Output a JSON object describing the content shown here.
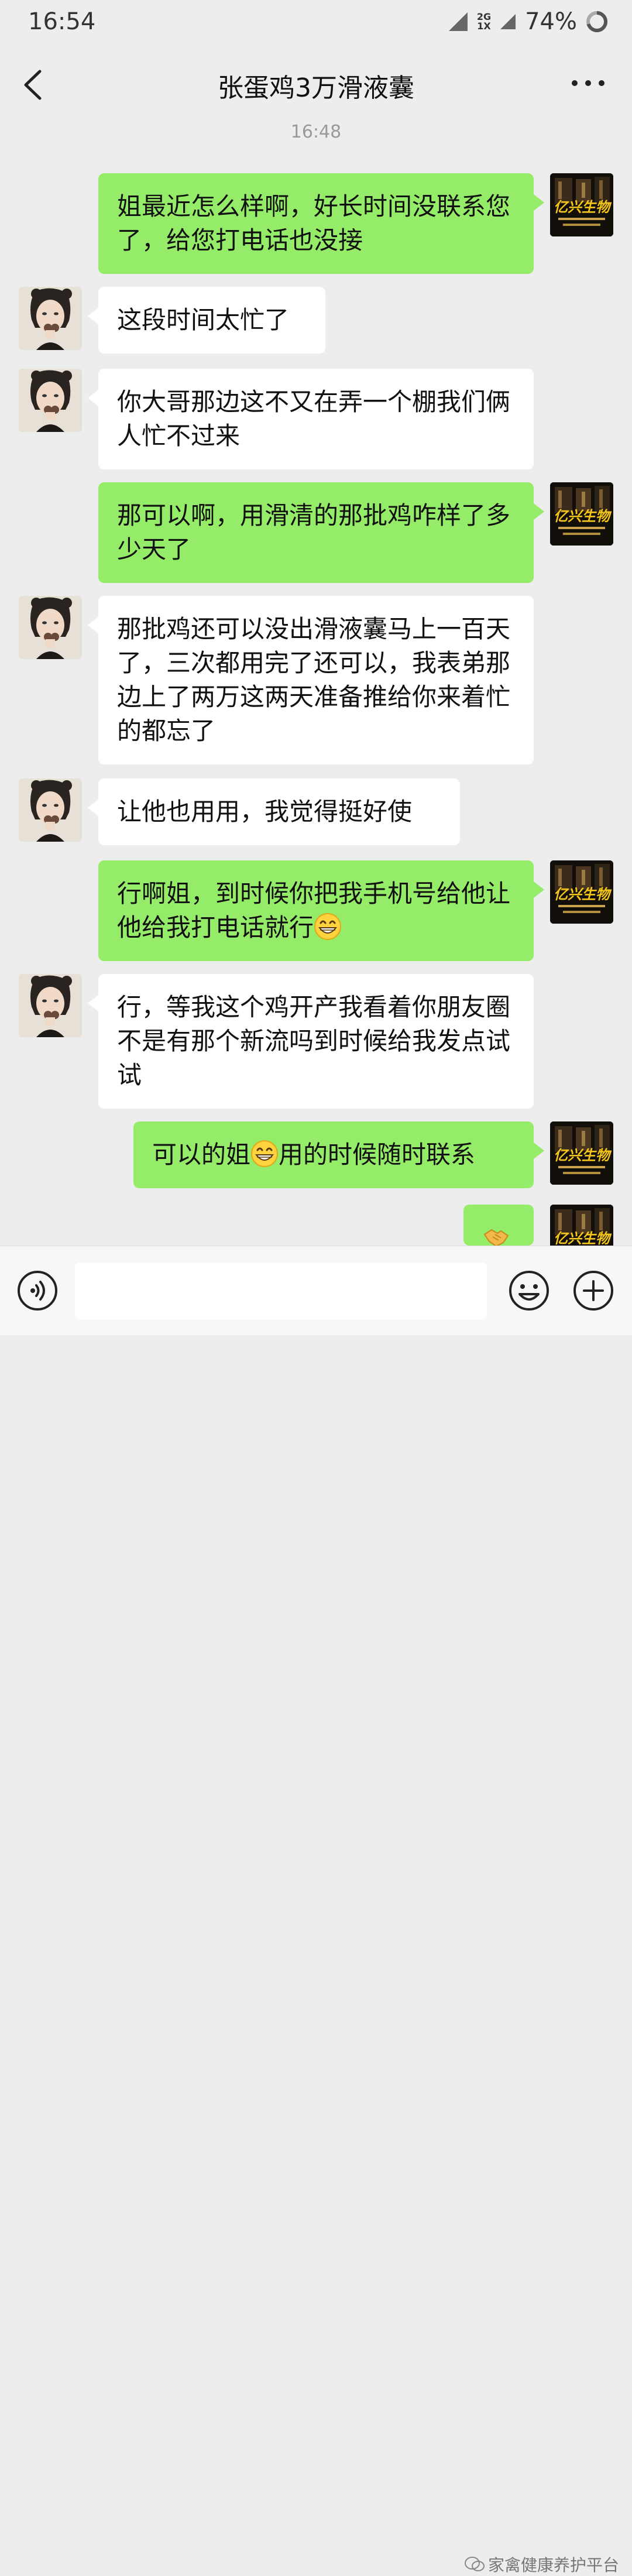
{
  "status_bar": {
    "time": "16:54",
    "network_top": "2G",
    "network_bottom": "1X",
    "battery": "74%"
  },
  "header": {
    "title": "张蛋鸡3万滑液囊",
    "back_icon": "chevron-left-icon",
    "more_icon": "more-dots-icon"
  },
  "timestamp": "16:48",
  "self_avatar_brand": "亿兴生物",
  "messages": [
    {
      "sender": "self",
      "text": "姐最近怎么样啊，好长时间没联系您了，给您打电话也没接"
    },
    {
      "sender": "other",
      "text": "这段时间太忙了"
    },
    {
      "sender": "other",
      "text": "你大哥那边这不又在弄一个棚我们俩人忙不过来"
    },
    {
      "sender": "self",
      "text": "那可以啊，用滑清的那批鸡咋样了多少天了"
    },
    {
      "sender": "other",
      "text": "那批鸡还可以没出滑液囊马上一百天了，三次都用完了还可以，我表弟那边上了两万这两天准备推给你来着忙的都忘了"
    },
    {
      "sender": "other",
      "text": "让他也用用，我觉得挺好使"
    },
    {
      "sender": "self",
      "text": "行啊姐，到时候你把我手机号给他让他给我打电话就行",
      "emoji_end": "grin-emoji"
    },
    {
      "sender": "other",
      "text": "行，等我这个鸡开产我看着你朋友圈不是有那个新流吗到时候给我发点试试"
    },
    {
      "sender": "self",
      "text_before": "可以的姐",
      "emoji_mid": "grin-emoji",
      "text_after": "用的时候随时联系"
    },
    {
      "sender": "self",
      "emoji_only": "handshake-emoji"
    }
  ],
  "input_bar": {
    "voice_icon": "voice-icon",
    "emoji_icon": "emoji-face-icon",
    "plus_icon": "plus-circle-icon",
    "input_value": ""
  },
  "watermark": "家禽健康养护平台",
  "colors": {
    "background": "#ededed",
    "bubble_self": "#95ec69",
    "bubble_other": "#ffffff"
  }
}
